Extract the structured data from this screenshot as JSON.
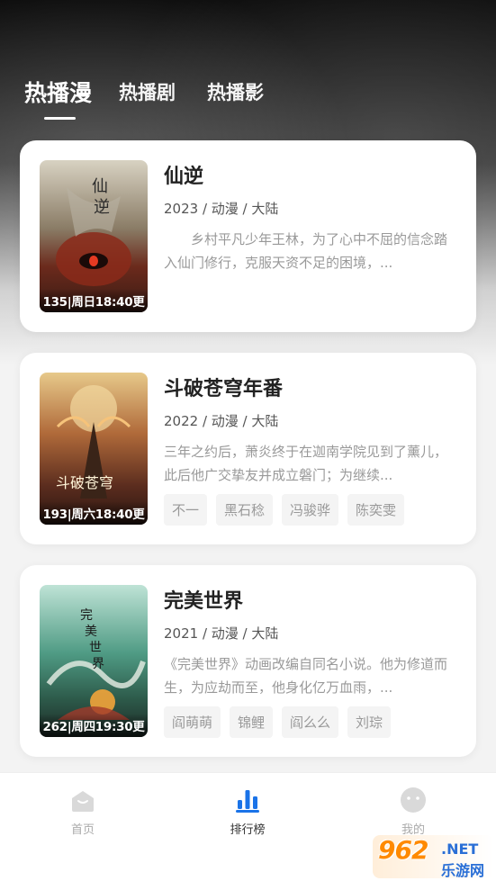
{
  "tabs": [
    {
      "label": "热播漫",
      "active": true
    },
    {
      "label": "热播剧",
      "active": false
    },
    {
      "label": "热播影",
      "active": false
    }
  ],
  "items": [
    {
      "title": "仙逆",
      "meta": "2023 / 动漫 / 大陆",
      "description": "乡村平凡少年王林，为了心中不屈的信念踏入仙门修行，克服天资不足的困境，...",
      "poster_caption": "135|周日18:40更",
      "tags": []
    },
    {
      "title": "斗破苍穹年番",
      "meta": "2022 / 动漫 / 大陆",
      "description": "三年之约后，萧炎终于在迦南学院见到了薰儿，此后他广交挚友并成立磐门；为继续...",
      "poster_caption": "193|周六18:40更",
      "tags": [
        "不一",
        "黑石稔",
        "冯骏骅",
        "陈奕雯"
      ]
    },
    {
      "title": "完美世界",
      "meta": "2021 / 动漫 / 大陆",
      "description": "《完美世界》动画改编自同名小说。他为修道而生，为应劫而至，他身化亿万血雨，...",
      "poster_caption": "262|周四19:30更",
      "tags": [
        "阎萌萌",
        "锦鲤",
        "阎么么",
        "刘琮"
      ]
    }
  ],
  "bottom_nav": [
    {
      "label": "首页",
      "icon": "home-icon",
      "active": false
    },
    {
      "label": "排行榜",
      "icon": "bar-chart-icon",
      "active": true
    },
    {
      "label": "我的",
      "icon": "profile-icon",
      "active": false
    }
  ],
  "watermark": {
    "brand": "962",
    "net": ".NET",
    "sub": "乐游网"
  },
  "colors": {
    "accent": "#1a73e8",
    "text_primary": "#222222",
    "text_muted": "#999999"
  }
}
